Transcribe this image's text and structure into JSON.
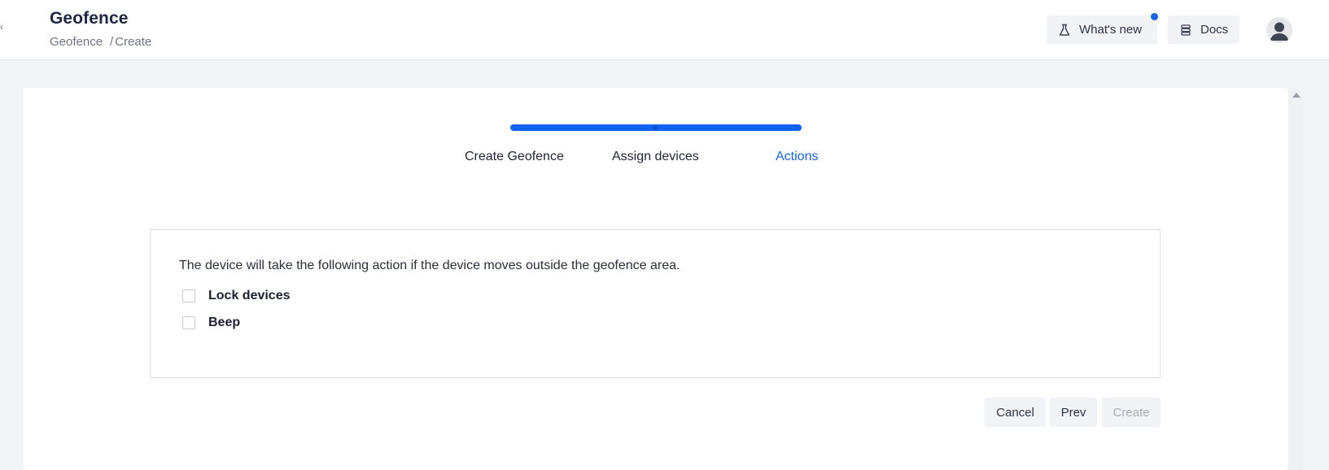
{
  "header": {
    "title": "Geofence",
    "breadcrumb": [
      {
        "label": "Geofence"
      },
      {
        "label": "/"
      },
      {
        "label": "Create"
      }
    ],
    "whats_new_label": "What's new",
    "docs_label": "Docs",
    "notification_color": "#1565e0"
  },
  "stepper": {
    "steps": [
      {
        "label": "Create Geofence",
        "state": "completed"
      },
      {
        "label": "Assign devices",
        "state": "completed"
      },
      {
        "label": "Actions",
        "state": "active"
      }
    ],
    "progress_color": "#1162f0",
    "active_color": "#1565e0"
  },
  "actions": {
    "description": "The device will take the following action if the device moves outside the geofence area.",
    "options": [
      {
        "label": "Lock devices",
        "checked": false
      },
      {
        "label": "Beep",
        "checked": false
      }
    ]
  },
  "footer": {
    "cancel_label": "Cancel",
    "prev_label": "Prev",
    "create_label": "Create",
    "create_disabled": true
  }
}
